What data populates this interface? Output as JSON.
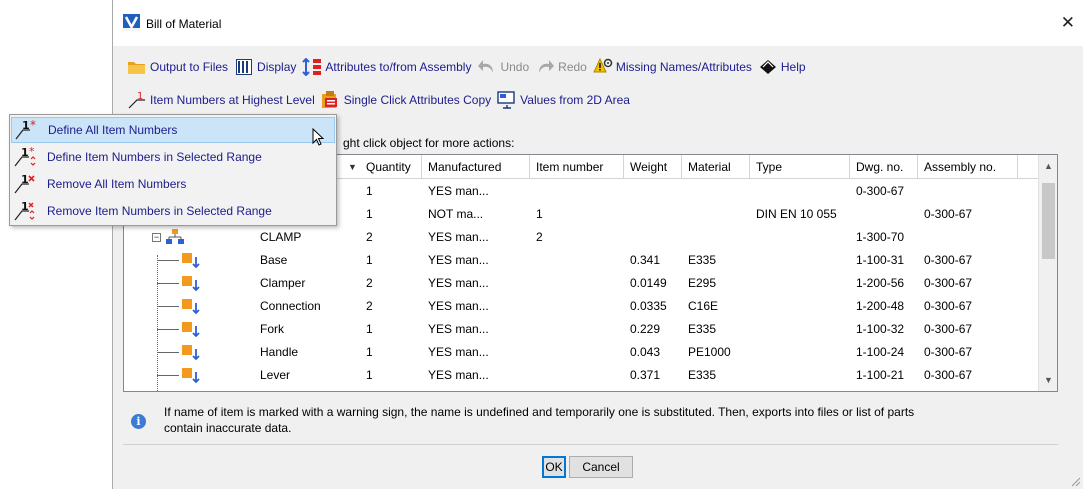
{
  "window": {
    "title": "Bill of Material",
    "close": "✕"
  },
  "toolbar": {
    "row1": [
      {
        "label": "Output to Files",
        "icon": "folder-icon",
        "disabled": false
      },
      {
        "label": "Display",
        "icon": "columns-icon",
        "disabled": false
      },
      {
        "label": "Attributes to/from Assembly",
        "icon": "attributes-transfer-icon",
        "disabled": false
      },
      {
        "label": "Undo",
        "icon": "undo-icon",
        "disabled": true
      },
      {
        "label": "Redo",
        "icon": "redo-icon",
        "disabled": true
      },
      {
        "label": "Missing Names/Attributes",
        "icon": "warning-gear-icon",
        "disabled": false
      },
      {
        "label": "Help",
        "icon": "help-diamond-icon",
        "disabled": false
      }
    ],
    "row2": [
      {
        "label": "Item Numbers at Highest Level",
        "icon": "item-number-icon"
      },
      {
        "label": "Single Click Attributes Copy",
        "icon": "attribute-copy-icon"
      },
      {
        "label": "Values from 2D Area",
        "icon": "2d-area-icon"
      }
    ]
  },
  "hint": "ght click object for more actions:",
  "table": {
    "columns": [
      "Quantity",
      "Manufactured",
      "Item number",
      "Weight",
      "Material",
      "Type",
      "Dwg. no.",
      "Assembly no."
    ],
    "rows": [
      {
        "name": "",
        "qty": "1",
        "man": "YES man...",
        "item": "",
        "weight": "",
        "mat": "",
        "type": "",
        "dwg": "0-300-67",
        "asm": ""
      },
      {
        "name": "",
        "qty": "1",
        "man": "NOT ma...",
        "item": "1",
        "weight": "",
        "mat": "",
        "type": "DIN EN 10 055",
        "dwg": "",
        "asm": "0-300-67"
      },
      {
        "name": "CLAMP",
        "qty": "2",
        "man": "YES man...",
        "item": "2",
        "weight": "",
        "mat": "",
        "type": "",
        "dwg": "1-300-70",
        "asm": ""
      },
      {
        "name": "Base",
        "qty": "1",
        "man": "YES man...",
        "item": "",
        "weight": "0.341",
        "mat": "E335",
        "type": "",
        "dwg": "1-100-31",
        "asm": "0-300-67"
      },
      {
        "name": "Clamper",
        "qty": "2",
        "man": "YES man...",
        "item": "",
        "weight": "0.0149",
        "mat": "E295",
        "type": "",
        "dwg": "1-200-56",
        "asm": "0-300-67"
      },
      {
        "name": "Connection",
        "qty": "2",
        "man": "YES man...",
        "item": "",
        "weight": "0.0335",
        "mat": "C16E",
        "type": "",
        "dwg": "1-200-48",
        "asm": "0-300-67"
      },
      {
        "name": "Fork",
        "qty": "1",
        "man": "YES man...",
        "item": "",
        "weight": "0.229",
        "mat": "E335",
        "type": "",
        "dwg": "1-100-32",
        "asm": "0-300-67"
      },
      {
        "name": "Handle",
        "qty": "1",
        "man": "YES man...",
        "item": "",
        "weight": "0.043",
        "mat": "PE1000",
        "type": "",
        "dwg": "1-100-24",
        "asm": "0-300-67"
      },
      {
        "name": "Lever",
        "qty": "1",
        "man": "YES man...",
        "item": "",
        "weight": "0.371",
        "mat": "E335",
        "type": "",
        "dwg": "1-100-21",
        "asm": "0-300-67"
      }
    ]
  },
  "info": "If name of item is marked with a warning sign, the name is undefined and temporarily one is substituted. Then, exports into files or list of parts contain inaccurate data.",
  "buttons": {
    "ok": "OK",
    "cancel": "Cancel"
  },
  "popup": {
    "items": [
      {
        "label": "Define All Item Numbers",
        "icon": "define-all-icon",
        "selected": true
      },
      {
        "label": "Define Item Numbers in Selected Range",
        "icon": "define-range-icon",
        "selected": false
      },
      {
        "label": "Remove All Item Numbers",
        "icon": "remove-all-icon",
        "selected": false
      },
      {
        "label": "Remove Item Numbers in Selected Range",
        "icon": "remove-range-icon",
        "selected": false
      }
    ]
  },
  "colors": {
    "link": "#1c1c8c",
    "selection": "#cce4f7",
    "part": "#f39a1e",
    "arrow": "#2d5fd6"
  }
}
